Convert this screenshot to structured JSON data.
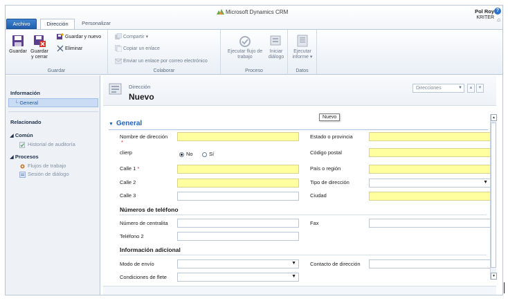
{
  "app": {
    "brand": "Microsoft Dynamics CRM",
    "user_name": "Pol Roy",
    "org_name": "KRITER",
    "help_icon": "help-icon",
    "accent": "#1e63b8"
  },
  "tabs": [
    {
      "label": "Archivo"
    },
    {
      "label": "Dirección"
    },
    {
      "label": "Personalizar"
    }
  ],
  "ribbon": {
    "groups": {
      "guardar": "Guardar",
      "colaborar": "Colaborar",
      "proceso": "Proceso",
      "datos": "Datos"
    },
    "guardar_label": "Guardar",
    "guardar_cerrar_label": "Guardar y cerrar",
    "guardar_nuevo_label": "Guardar y nuevo",
    "eliminar_label": "Eliminar",
    "compartir_label": "Compartir ▾",
    "copiar_enlace_label": "Copiar un enlace",
    "enviar_enlace_label": "Enviar un enlace por correo electrónico",
    "flujo_label": "Ejecutar flujo de trabajo",
    "dialogo_label": "Iniciar diálogo",
    "informe_label": "Ejecutar informe ▾"
  },
  "nav": {
    "informacion": "Información",
    "general": "General",
    "relacionado": "Relacionado",
    "comun": "Común",
    "historial": "Historial de auditoría",
    "procesos": "Procesos",
    "flujos": "Flujos de trabajo",
    "sesion": "Sesión de diálogo"
  },
  "record": {
    "entity": "Dirección",
    "name": "Nuevo",
    "views_placeholder": "Direcciones",
    "tooltip": "Nuevo"
  },
  "form": {
    "section_general": "General",
    "left_fields": {
      "nombre": "Nombre de dirección",
      "clierp": "clierp",
      "calle1": "Calle 1",
      "calle2": "Calle 2",
      "calle3": "Calle 3"
    },
    "radio": {
      "no": "No",
      "si": "Sí",
      "selected": "No"
    },
    "right_fields": {
      "estado": "Estado o provincia",
      "codigo": "Código postal",
      "pais": "País o región",
      "tipo": "Tipo de dirección",
      "ciudad": "Ciudad"
    },
    "subsection_telefono": "Números de teléfono",
    "telefono_fields": {
      "centralita": "Número de centralita",
      "telefono2": "Teléfono 2",
      "fax": "Fax"
    },
    "subsection_info": "Información adicional",
    "info_fields": {
      "modo_envio": "Modo de envío",
      "condiciones": "Condiciones de flete",
      "contacto": "Contacto de dirección"
    },
    "required_color": "#ffff9f"
  }
}
